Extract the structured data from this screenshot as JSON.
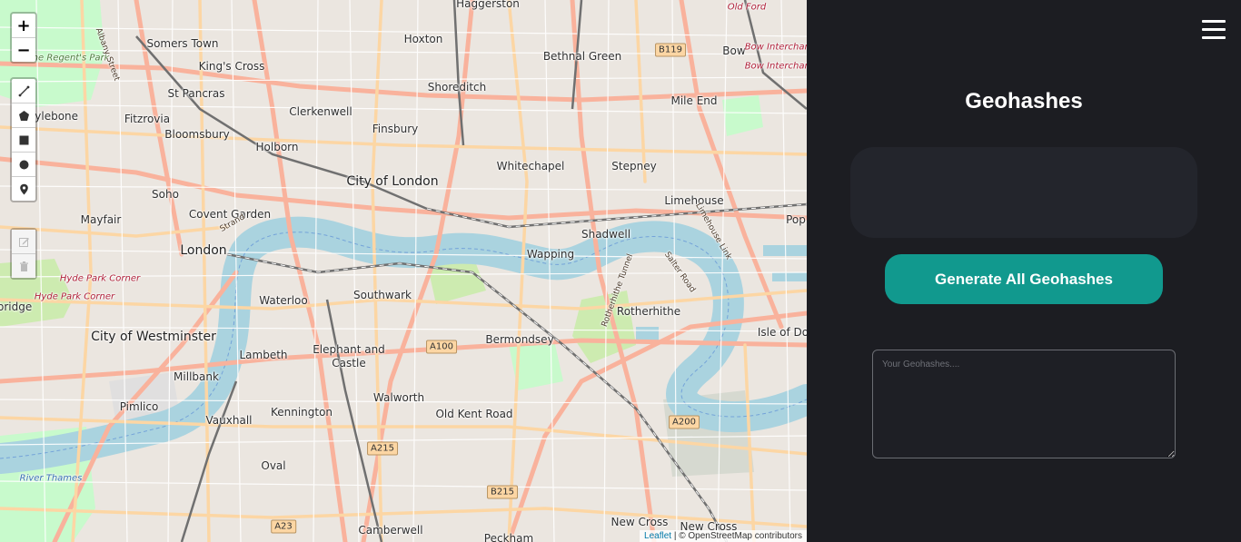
{
  "map": {
    "places": [
      {
        "name": "Haggerston",
        "cls": ""
      },
      {
        "name": "Somers Town",
        "cls": ""
      },
      {
        "name": "King's Cross",
        "cls": ""
      },
      {
        "name": "Hoxton",
        "cls": ""
      },
      {
        "name": "Bethnal Green",
        "cls": ""
      },
      {
        "name": "Bow",
        "cls": ""
      },
      {
        "name": "St Pancras",
        "cls": ""
      },
      {
        "name": "Shoreditch",
        "cls": ""
      },
      {
        "name": "Mile End",
        "cls": ""
      },
      {
        "name": "arylebone",
        "cls": ""
      },
      {
        "name": "Fitzrovia",
        "cls": ""
      },
      {
        "name": "Clerkenwell",
        "cls": ""
      },
      {
        "name": "Finsbury",
        "cls": ""
      },
      {
        "name": "Bloomsbury",
        "cls": ""
      },
      {
        "name": "Holborn",
        "cls": ""
      },
      {
        "name": "Whitechapel",
        "cls": ""
      },
      {
        "name": "Stepney",
        "cls": ""
      },
      {
        "name": "City of London",
        "cls": "big"
      },
      {
        "name": "Soho",
        "cls": ""
      },
      {
        "name": "Limehouse",
        "cls": ""
      },
      {
        "name": "Mayfair",
        "cls": ""
      },
      {
        "name": "Covent Garden",
        "cls": ""
      },
      {
        "name": "Pop",
        "cls": ""
      },
      {
        "name": "Shadwell",
        "cls": ""
      },
      {
        "name": "London",
        "cls": "big"
      },
      {
        "name": "Wapping",
        "cls": ""
      },
      {
        "name": "Hyde Park Corner",
        "cls": "red"
      },
      {
        "name": "Hyde Park Corner",
        "cls": "red"
      },
      {
        "name": "Waterloo",
        "cls": ""
      },
      {
        "name": "Southwark",
        "cls": ""
      },
      {
        "name": "bridge",
        "cls": ""
      },
      {
        "name": "Rotherhithe",
        "cls": ""
      },
      {
        "name": "City of Westminster",
        "cls": "big"
      },
      {
        "name": "Isle of Do",
        "cls": ""
      },
      {
        "name": "Bermondsey",
        "cls": ""
      },
      {
        "name": "Lambeth",
        "cls": ""
      },
      {
        "name": "Elephant and",
        "cls": ""
      },
      {
        "name": "Castle",
        "cls": ""
      },
      {
        "name": "Millbank",
        "cls": ""
      },
      {
        "name": "Walworth",
        "cls": ""
      },
      {
        "name": "Pimlico",
        "cls": ""
      },
      {
        "name": "Kennington",
        "cls": ""
      },
      {
        "name": "Old Kent Road",
        "cls": ""
      },
      {
        "name": "Vauxhall",
        "cls": ""
      },
      {
        "name": "Oval",
        "cls": ""
      },
      {
        "name": "New Cross",
        "cls": ""
      },
      {
        "name": "New Cross",
        "cls": ""
      },
      {
        "name": "Camberwell",
        "cls": ""
      },
      {
        "name": "Peckham",
        "cls": ""
      },
      {
        "name": "Old Ford",
        "cls": "red"
      },
      {
        "name": "Bow Interchange",
        "cls": "red"
      },
      {
        "name": "Bow Interchange",
        "cls": "red"
      },
      {
        "name": "The Regent's Park",
        "cls": "italic"
      },
      {
        "name": "River Thames",
        "cls": "water"
      },
      {
        "name": "Strand",
        "cls": "road"
      },
      {
        "name": "Albany Street",
        "cls": "road"
      },
      {
        "name": "Rotherhithe Tunnel",
        "cls": "road"
      },
      {
        "name": "Salter Road",
        "cls": "road"
      },
      {
        "name": "Limehouse Link",
        "cls": "road"
      }
    ],
    "shields": [
      "B119",
      "A100",
      "A200",
      "A215",
      "B215",
      "A23"
    ],
    "controls": {
      "zoom_in": "+",
      "zoom_out": "−"
    },
    "attribution": {
      "link": "Leaflet",
      "text": " | © OpenStreetMap contributors"
    }
  },
  "panel": {
    "title": "Geohashes",
    "generate_button": "Generate All Geohashes",
    "output_placeholder": "Your Geohashes...."
  },
  "colors": {
    "panel_bg": "#1c1d22",
    "accent": "#11998e",
    "map_water": "#aad3df",
    "map_park": "#c8facc",
    "map_major_road": "#f9b29c",
    "map_secondary_road": "#fcd6a4",
    "map_rail": "#707070"
  }
}
